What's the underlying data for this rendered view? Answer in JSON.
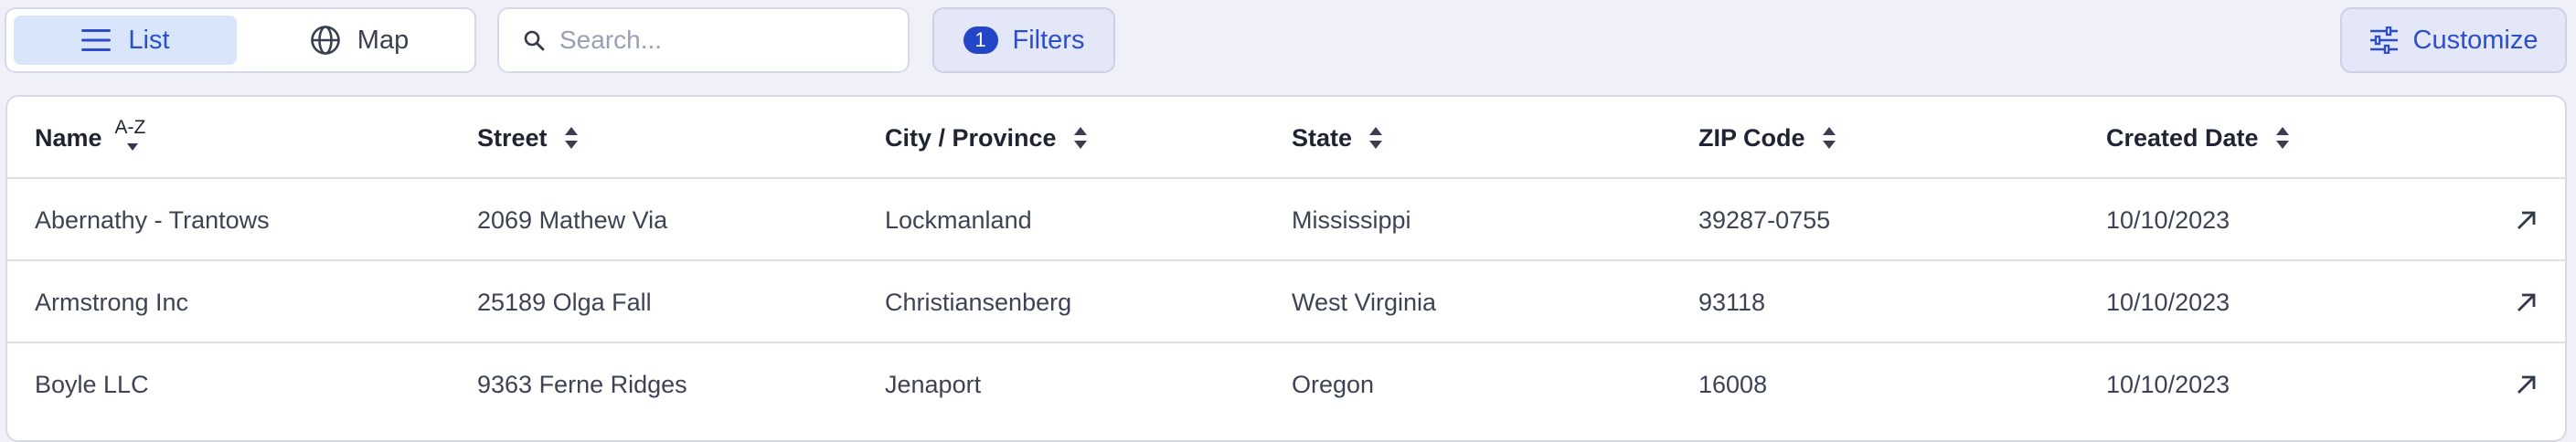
{
  "toolbar": {
    "view_toggle": {
      "list_label": "List",
      "map_label": "Map",
      "selected": "List"
    },
    "search": {
      "placeholder": "Search...",
      "value": ""
    },
    "filters": {
      "count": "1",
      "label": "Filters"
    },
    "customize_label": "Customize"
  },
  "table": {
    "columns": [
      {
        "label": "Name",
        "sort": "A-Z"
      },
      {
        "label": "Street",
        "sort": "none"
      },
      {
        "label": "City / Province",
        "sort": "none"
      },
      {
        "label": "State",
        "sort": "none"
      },
      {
        "label": "ZIP Code",
        "sort": "none"
      },
      {
        "label": "Created Date",
        "sort": "none"
      }
    ],
    "rows": [
      {
        "name": "Abernathy - Trantows",
        "street": "2069 Mathew Via",
        "city": "Lockmanland",
        "state": "Mississippi",
        "zip": "39287-0755",
        "created": "10/10/2023"
      },
      {
        "name": "Armstrong Inc",
        "street": "25189 Olga Fall",
        "city": "Christiansenberg",
        "state": "West Virginia",
        "zip": "93118",
        "created": "10/10/2023"
      },
      {
        "name": "Boyle LLC",
        "street": "9363 Ferne Ridges",
        "city": "Jenaport",
        "state": "Oregon",
        "zip": "16008",
        "created": "10/10/2023"
      }
    ]
  },
  "colors": {
    "accent": "#2c4fc9",
    "selected_bg": "#d9e5fb",
    "page_bg": "#f0f1f8"
  },
  "icons": {
    "list": "list-icon",
    "map": "globe-icon",
    "search": "search-icon",
    "customize": "sliders-icon",
    "sort": "sort-icon",
    "open": "arrow-up-right-icon"
  }
}
